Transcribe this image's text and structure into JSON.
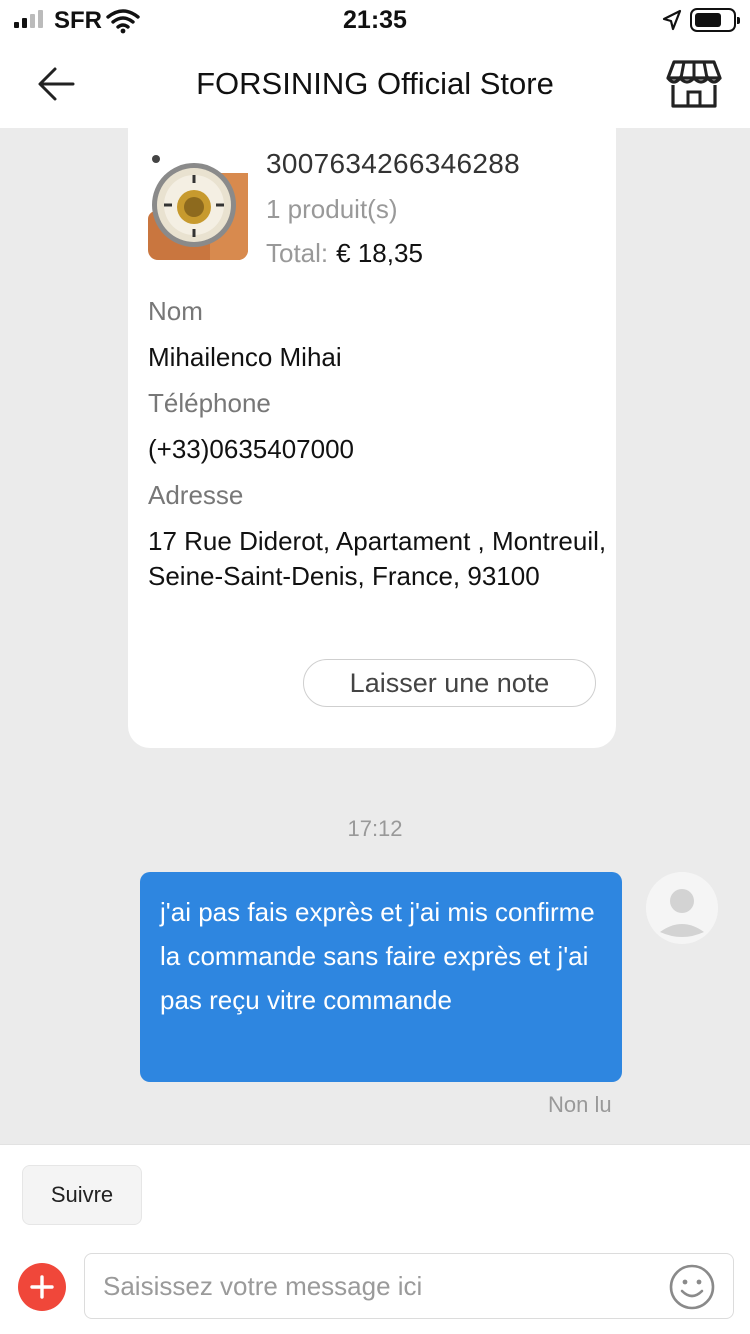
{
  "status_bar": {
    "carrier": "SFR",
    "time": "21:35",
    "battery_level": 0.6
  },
  "header": {
    "title": "FORSINING Official Store",
    "icons": [
      "back-arrow-icon",
      "store-icon"
    ]
  },
  "order_card": {
    "order_id": "3007634266346288",
    "product_count": "1 produit(s)",
    "total_label": "Total:",
    "total_value": "€ 18,35",
    "name_label": "Nom",
    "name_value": "Mihailenco Mihai",
    "phone_label": "Téléphone",
    "phone_value": "(+33)0635407000",
    "address_label": "Adresse",
    "address_value": "17 Rue Diderot, Apartament , Montreuil, Seine-Saint-Denis, France, 93100",
    "note_button": "Laisser une note"
  },
  "chat": {
    "timestamp": "17:12",
    "message": "j'ai pas fais exprès et j'ai mis confirme la commande sans faire exprès et j'ai pas reçu vitre commande",
    "read_status": "Non lu",
    "bubble_color": "#2e86e0"
  },
  "bottom_bar": {
    "follow_button": "Suivre",
    "input_placeholder": "Saisissez votre message ici",
    "plus_color": "#f0473a",
    "icons": [
      "plus-icon",
      "emoji-icon"
    ]
  }
}
